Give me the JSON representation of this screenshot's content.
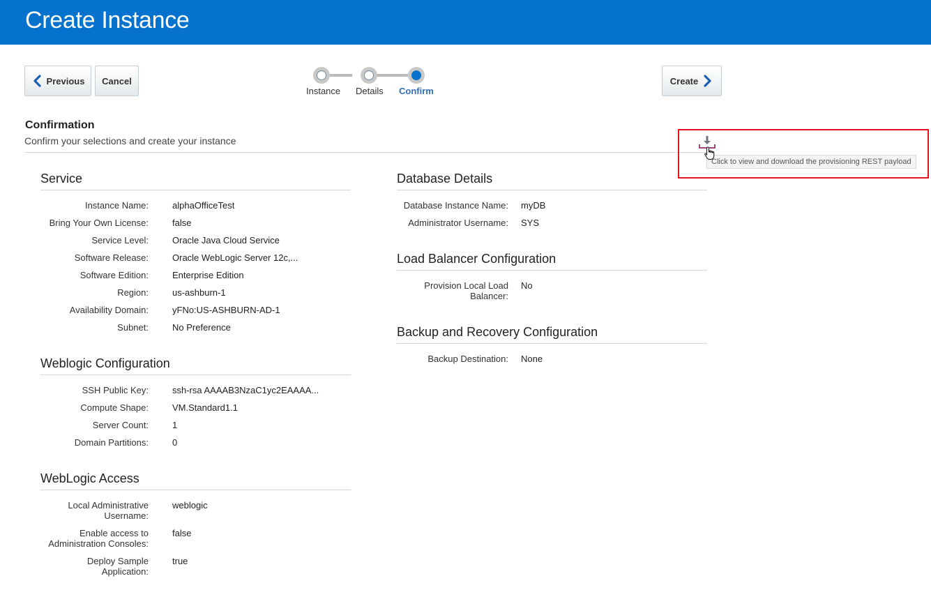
{
  "header": {
    "title": "Create Instance"
  },
  "toolbar": {
    "previous_label": "Previous",
    "cancel_label": "Cancel",
    "create_label": "Create"
  },
  "train": {
    "stops": [
      {
        "label": "Instance",
        "state": "visited"
      },
      {
        "label": "Details",
        "state": "visited"
      },
      {
        "label": "Confirm",
        "state": "current"
      }
    ]
  },
  "confirmation": {
    "title": "Confirmation",
    "subtitle": "Confirm your selections and create your instance",
    "download_tooltip": "Click to view and download the provisioning REST payload"
  },
  "service": {
    "title": "Service",
    "rows": [
      {
        "label": "Instance Name:",
        "value": "alphaOfficeTest"
      },
      {
        "label": "Bring Your Own License:",
        "value": "false"
      },
      {
        "label": "Service Level:",
        "value": "Oracle Java Cloud Service"
      },
      {
        "label": "Software Release:",
        "value": "Oracle WebLogic Server 12c,..."
      },
      {
        "label": "Software Edition:",
        "value": "Enterprise Edition"
      },
      {
        "label": "Region:",
        "value": "us-ashburn-1"
      },
      {
        "label": "Availability Domain:",
        "value": "yFNo:US-ASHBURN-AD-1"
      },
      {
        "label": "Subnet:",
        "value": "No Preference"
      }
    ]
  },
  "weblogic_config": {
    "title": "Weblogic Configuration",
    "rows": [
      {
        "label": "SSH Public Key:",
        "value": "ssh-rsa AAAAB3NzaC1yc2EAAAA..."
      },
      {
        "label": "Compute Shape:",
        "value": "VM.Standard1.1"
      },
      {
        "label": "Server Count:",
        "value": "1"
      },
      {
        "label": "Domain Partitions:",
        "value": "0"
      }
    ]
  },
  "weblogic_access": {
    "title": "WebLogic Access",
    "rows": [
      {
        "label_1": "Local Administrative",
        "label_2": "Username:",
        "value": "weblogic"
      },
      {
        "label_1": "Enable access to",
        "label_2": "Administration Consoles:",
        "value": "false"
      },
      {
        "label_1": "Deploy Sample",
        "label_2": "Application:",
        "value": "true"
      }
    ]
  },
  "database": {
    "title": "Database Details",
    "rows": [
      {
        "label": "Database Instance Name:",
        "value": "myDB"
      },
      {
        "label": "Administrator Username:",
        "value": "SYS"
      }
    ]
  },
  "load_balancer": {
    "title": "Load Balancer Configuration",
    "rows": [
      {
        "label_1": "Provision Local Load",
        "label_2": "Balancer:",
        "value": "No"
      }
    ]
  },
  "backup": {
    "title": "Backup and Recovery Configuration",
    "rows": [
      {
        "label": "Backup Destination:",
        "value": "None"
      }
    ]
  },
  "colors": {
    "header_bg": "#0572ce",
    "accent": "#0572ce",
    "highlight_border": "#e0171e"
  },
  "icons": [
    "chevron-left-icon",
    "chevron-right-icon",
    "download-icon",
    "hand-cursor-icon"
  ]
}
